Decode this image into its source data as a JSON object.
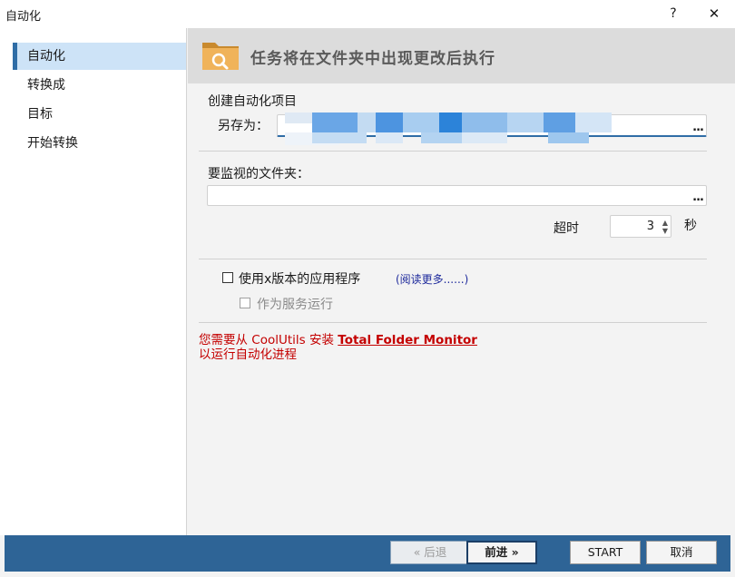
{
  "window": {
    "title": "自动化",
    "help": "?",
    "close": "✕"
  },
  "sidebar": {
    "items": [
      {
        "label": "自动化",
        "active": true
      },
      {
        "label": "转换成"
      },
      {
        "label": "目标"
      },
      {
        "label": "开始转换"
      }
    ]
  },
  "header": {
    "heading": "任务将在文件夹中出现更改后执行",
    "icon": "folder-search-icon"
  },
  "create": {
    "section_label": "创建自动化项目",
    "save_as_label": "另存为：",
    "save_as_value": "",
    "browse": "..."
  },
  "watch": {
    "label": "要监视的文件夹：",
    "value": "",
    "browse": "...",
    "timeout_label": "超时",
    "timeout_value": "3",
    "timeout_unit": "秒"
  },
  "options": {
    "use_x_label": "使用x版本的应用程序",
    "use_x_checked": false,
    "read_more": "(阅读更多......)",
    "as_service_label": "作为服务运行",
    "as_service_checked": false,
    "as_service_enabled": false
  },
  "warning": {
    "prefix": "您需要从 CoolUtils 安装 ",
    "product": "Total Folder Monitor",
    "line2": "以运行自动化进程"
  },
  "footer": {
    "back": "« 后退",
    "next": "前进 »",
    "start": "START",
    "cancel": "取消"
  },
  "colors": {
    "accent": "#2f6da6",
    "footer": "#2e6496",
    "warning": "#c40000",
    "link": "#1e2a9c"
  }
}
